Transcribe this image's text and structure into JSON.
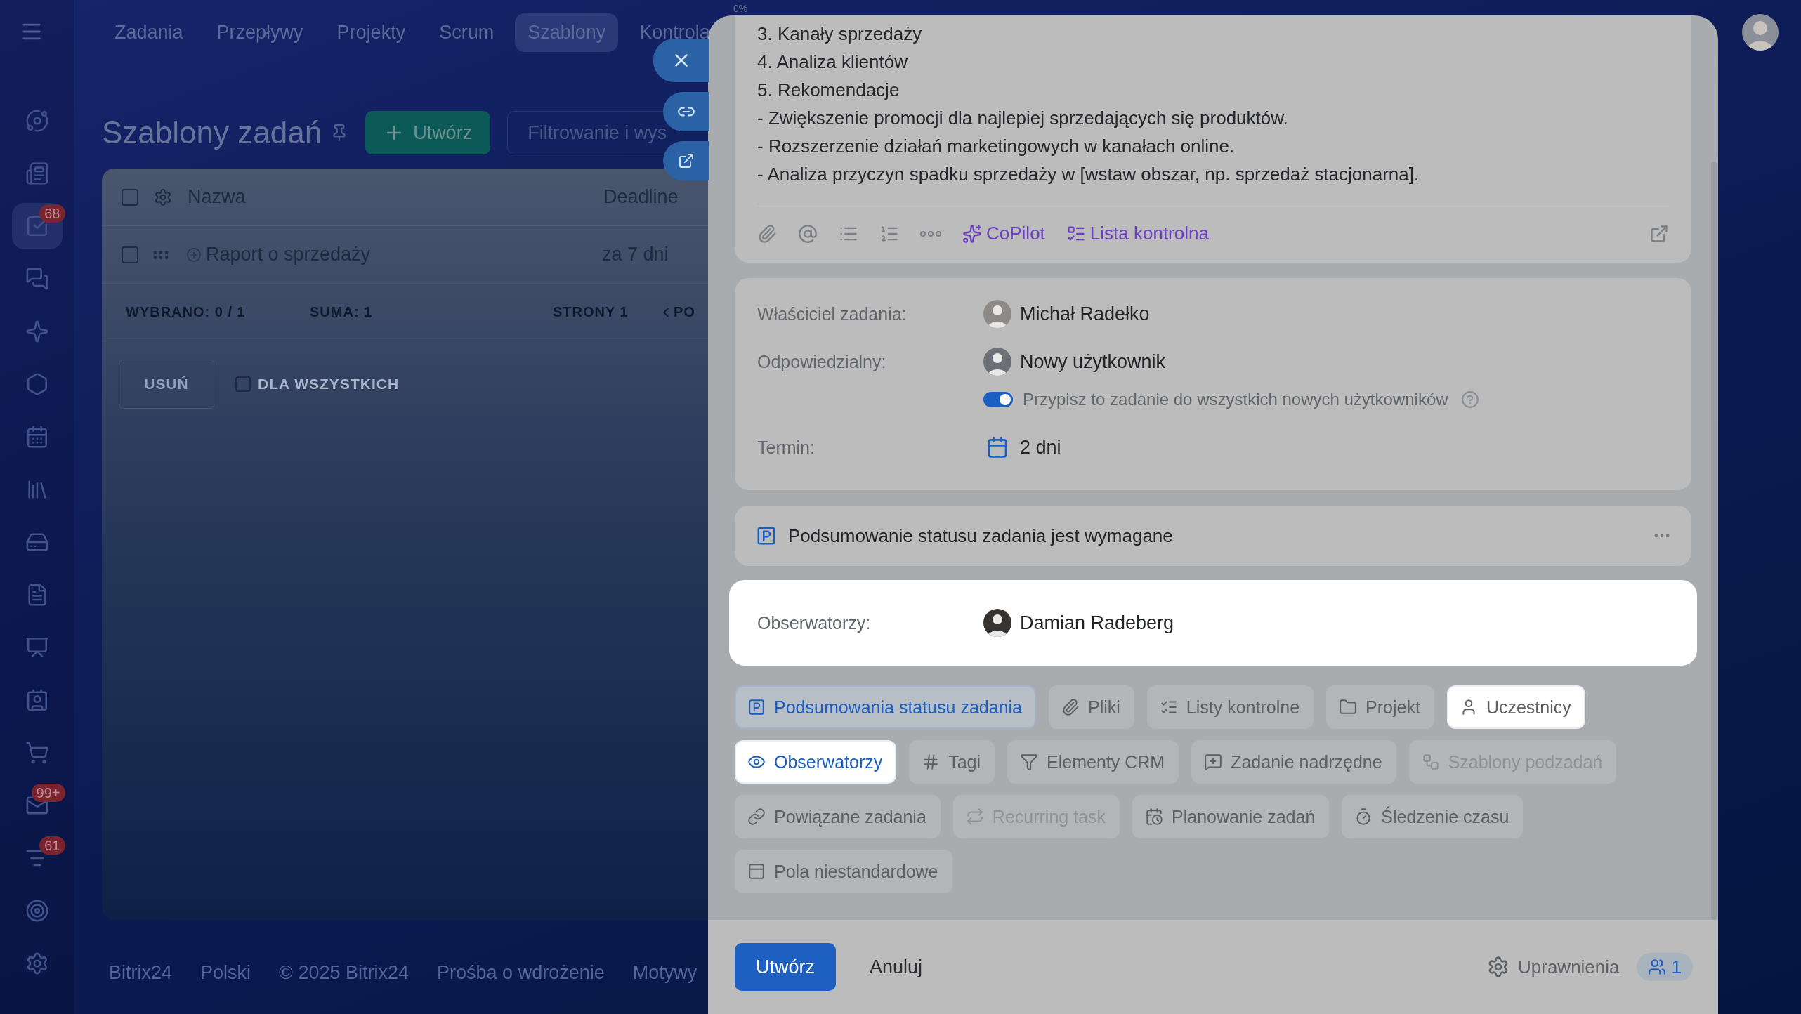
{
  "top_nav": {
    "items": [
      {
        "label": "Zadania",
        "selected": false
      },
      {
        "label": "Przepływy",
        "selected": false
      },
      {
        "label": "Projekty",
        "selected": false
      },
      {
        "label": "Scrum",
        "selected": false
      },
      {
        "label": "Szablony",
        "selected": true
      },
      {
        "label": "Kontrola",
        "selected": false
      }
    ]
  },
  "sidebar": {
    "items": [
      {
        "kind": "feed",
        "selected": false
      },
      {
        "kind": "news",
        "selected": false
      },
      {
        "kind": "tasks",
        "selected": true,
        "badge": "68"
      },
      {
        "kind": "chat",
        "selected": false
      },
      {
        "kind": "copilot",
        "selected": false
      },
      {
        "kind": "hexagon",
        "selected": false
      },
      {
        "kind": "calendar",
        "selected": false
      },
      {
        "kind": "library",
        "selected": false
      },
      {
        "kind": "drive",
        "selected": false
      },
      {
        "kind": "document",
        "selected": false
      },
      {
        "kind": "board",
        "selected": false
      },
      {
        "kind": "contact",
        "selected": false
      },
      {
        "kind": "cart",
        "selected": false
      },
      {
        "kind": "mail",
        "selected": false,
        "badge": "99+"
      },
      {
        "kind": "filter",
        "selected": false,
        "badge": "61"
      },
      {
        "kind": "target",
        "selected": false
      },
      {
        "kind": "settings",
        "selected": false
      }
    ]
  },
  "page": {
    "title": "Szablony zadań",
    "create_button": "Utwórz",
    "filter_placeholder": "Filtrowanie i wys"
  },
  "grid": {
    "columns": [
      "Nazwa",
      "Deadline"
    ],
    "header_checked": false,
    "rows": [
      {
        "name": "Raport o sprzedaży",
        "deadline": "za 7 dni",
        "checked": false
      }
    ],
    "footer": {
      "selected_label": "WYBRANO:",
      "selected_value": "0 / 1",
      "total_label": "SUMA:",
      "total_value": "1",
      "pages_label": "STRONY",
      "pages_value": "1",
      "prev": "PO"
    },
    "actions": {
      "delete": "USUŃ",
      "for_all": "DLA WSZYSTKICH",
      "for_all_checked": false
    }
  },
  "footer_links": [
    "Bitrix24",
    "Polski",
    "© 2025 Bitrix24",
    "Prośba o wdrożenie",
    "Motywy"
  ],
  "panel": {
    "progress": "0%",
    "description_lines": [
      "3. Kanały sprzedaży",
      "4. Analiza klientów",
      "5. Rekomendacje",
      "- Zwiększenie promocji dla najlepiej sprzedających się produktów.",
      "- Rozszerzenie działań marketingowych w kanałach online.",
      "- Analiza przyczyn spadku sprzedaży w [wstaw obszar, np. sprzedaż stacjonarna]."
    ],
    "copilot": "CoPilot",
    "checklist": "Lista kontrolna",
    "fields": [
      {
        "kind": "person",
        "label": "Właściciel zadania:",
        "value": "Michał Radełko"
      },
      {
        "kind": "new_user",
        "label": "Odpowiedzialny:",
        "value": "Nowy użytkownik"
      },
      {
        "kind": "toggle",
        "label": "Przypisz to zadanie do wszystkich nowych użytkowników",
        "on": true
      },
      {
        "kind": "date",
        "label": "Termin:",
        "value": "2 dni"
      }
    ],
    "summary_required": "Podsumowanie statusu zadania jest wymagane",
    "observers": {
      "label": "Obserwatorzy:",
      "name": "Damian Radeberg"
    },
    "chips": [
      {
        "kind": "status",
        "label": "Podsumowania statusu zadania",
        "selected": true,
        "highlighted": false,
        "disabled": false
      },
      {
        "kind": "files",
        "label": "Pliki",
        "selected": false,
        "highlighted": false,
        "disabled": false
      },
      {
        "kind": "checklist",
        "label": "Listy kontrolne",
        "selected": false,
        "highlighted": false,
        "disabled": false
      },
      {
        "kind": "project",
        "label": "Projekt",
        "selected": false,
        "highlighted": false,
        "disabled": false
      },
      {
        "kind": "members",
        "label": "Uczestnicy",
        "selected": false,
        "highlighted": true,
        "disabled": false
      },
      {
        "kind": "observers",
        "label": "Obserwatorzy",
        "selected": true,
        "highlighted": true,
        "disabled": false
      },
      {
        "kind": "tags",
        "label": "Tagi",
        "selected": false,
        "highlighted": false,
        "disabled": false
      },
      {
        "kind": "crm",
        "label": "Elementy CRM",
        "selected": false,
        "highlighted": false,
        "disabled": false
      },
      {
        "kind": "parent",
        "label": "Zadanie nadrzędne",
        "selected": false,
        "highlighted": false,
        "disabled": false
      },
      {
        "kind": "subtasks",
        "label": "Szablony podzadań",
        "selected": false,
        "highlighted": false,
        "disabled": true
      },
      {
        "kind": "related",
        "label": "Powiązane zadania",
        "selected": false,
        "highlighted": false,
        "disabled": false
      },
      {
        "kind": "recurring",
        "label": "Recurring task",
        "selected": false,
        "highlighted": false,
        "disabled": true
      },
      {
        "kind": "planning",
        "label": "Planowanie zadań",
        "selected": false,
        "highlighted": false,
        "disabled": false
      },
      {
        "kind": "time",
        "label": "Śledzenie czasu",
        "selected": false,
        "highlighted": false,
        "disabled": false
      },
      {
        "kind": "custom",
        "label": "Pola niestandardowe",
        "selected": false,
        "highlighted": false,
        "disabled": false
      }
    ],
    "create_button": "Utwórz",
    "cancel_button": "Anuluj",
    "permissions": "Uprawnienia",
    "members_count": "1"
  }
}
